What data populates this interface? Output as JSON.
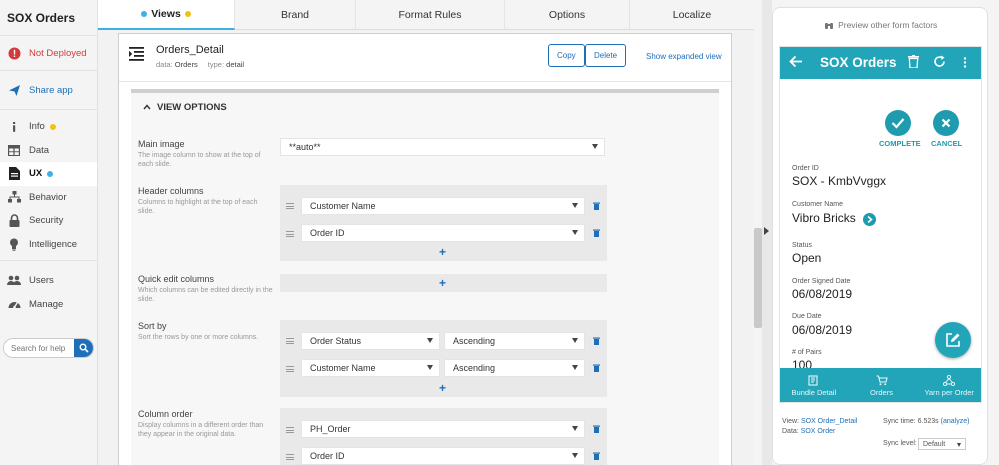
{
  "app": {
    "title": "SOX Orders"
  },
  "sidebar": {
    "deploy": "Not Deployed",
    "share": "Share app",
    "items": [
      {
        "label": "Info",
        "icon": "info-icon"
      },
      {
        "label": "Data",
        "icon": "table-icon"
      },
      {
        "label": "UX",
        "icon": "document-icon"
      },
      {
        "label": "Behavior",
        "icon": "sitemap-icon"
      },
      {
        "label": "Security",
        "icon": "lock-icon"
      },
      {
        "label": "Intelligence",
        "icon": "lightbulb-icon"
      }
    ],
    "bottom_items": [
      {
        "label": "Users",
        "icon": "users-icon"
      },
      {
        "label": "Manage",
        "icon": "dashboard-icon"
      }
    ],
    "help_placeholder": "Search for help"
  },
  "tabs": [
    "Views",
    "Brand",
    "Format Rules",
    "Options",
    "Localize"
  ],
  "view": {
    "name": "Orders_Detail",
    "data_label": "data:",
    "data_value": "Orders",
    "type_label": "type:",
    "type_value": "detail",
    "copy": "Copy",
    "delete": "Delete",
    "expand": "Show expanded view"
  },
  "view_options": {
    "heading": "VIEW OPTIONS",
    "main_image": {
      "label": "Main image",
      "desc": "The image column to show at the top of each slide.",
      "value": "**auto**"
    },
    "header_columns": {
      "label": "Header columns",
      "desc": "Columns to highlight at the top of each slide.",
      "values": [
        "Customer Name",
        "Order ID"
      ]
    },
    "quick_edit": {
      "label": "Quick edit columns",
      "desc": "Which columns can be edited directly in the slide."
    },
    "sort_by": {
      "label": "Sort by",
      "desc": "Sort the rows by one or more columns.",
      "rows": [
        {
          "column": "Order Status",
          "direction": "Ascending"
        },
        {
          "column": "Customer Name",
          "direction": "Ascending"
        }
      ]
    },
    "column_order": {
      "label": "Column order",
      "desc": "Display columns in a different order than they appear in the original data.",
      "values": [
        "PH_Order",
        "Order ID"
      ]
    },
    "add_symbol": "+"
  },
  "preview": {
    "other_forms": "Preview other form factors",
    "phone_title": "SOX Orders",
    "complete": "COMPLETE",
    "cancel": "CANCEL",
    "fields": [
      {
        "label": "Order ID",
        "value": "SOX - KmbVvggx"
      },
      {
        "label": "Customer Name",
        "value": "Vibro Bricks"
      },
      {
        "label": "Status",
        "value": "Open"
      },
      {
        "label": "Order Signed Date",
        "value": "06/08/2019"
      },
      {
        "label": "Due Date",
        "value": "06/08/2019"
      },
      {
        "label": "# of Pairs",
        "value": "100"
      }
    ],
    "nav": [
      "Bundle Detail",
      "Orders",
      "Yarn per Order"
    ],
    "footer": {
      "view_label": "View:",
      "view_value": "SOX Order_Detail",
      "data_label": "Data:",
      "data_value": "SOX Order",
      "sync_time_label": "Sync time:",
      "sync_time_value": "6.523s",
      "analyze": "(analyze)",
      "sync_level_label": "Sync level:",
      "sync_level_value": "Default"
    }
  },
  "colors": {
    "accent": "#1e6fb8",
    "teal": "#22a5b9",
    "deploy_red": "#d43a3a",
    "dot_yellow": "#f2c10e",
    "dot_blue": "#3fb0e4"
  }
}
